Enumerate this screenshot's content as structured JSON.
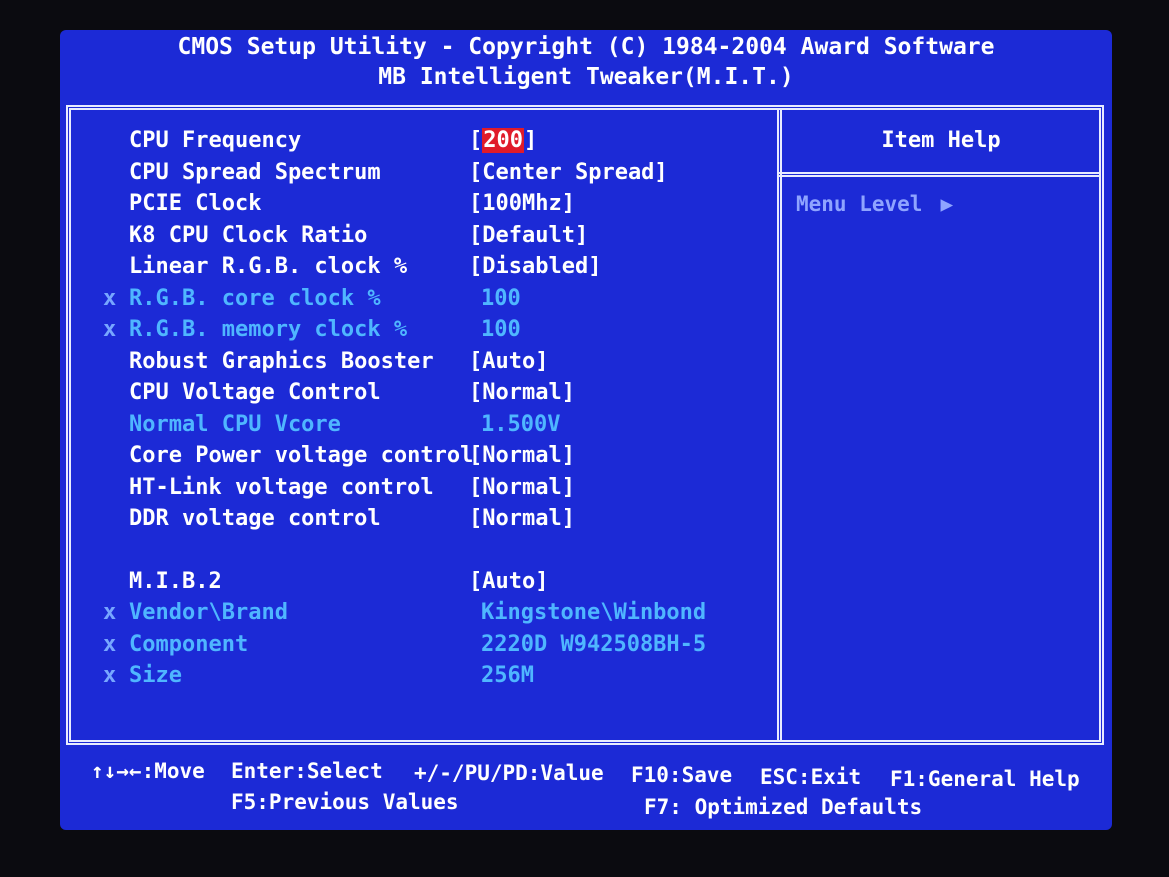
{
  "header": {
    "line1": "CMOS Setup Utility - Copyright (C) 1984-2004 Award Software",
    "line2": "MB Intelligent Tweaker(M.I.T.)"
  },
  "settings": [
    {
      "label": "CPU Frequency",
      "bracket_open": "[",
      "value": "200",
      "bracket_close": "]",
      "disabled": false,
      "mark": "",
      "selected": true
    },
    {
      "label": "CPU Spread Spectrum",
      "value": "[Center Spread]",
      "disabled": false,
      "mark": ""
    },
    {
      "label": "PCIE Clock",
      "value": "[100Mhz]",
      "disabled": false,
      "mark": ""
    },
    {
      "label": "K8 CPU Clock Ratio",
      "value": "[Default]",
      "disabled": false,
      "mark": ""
    },
    {
      "label": "Linear R.G.B. clock %",
      "value": "[Disabled]",
      "disabled": false,
      "mark": ""
    },
    {
      "label": "R.G.B. core clock %",
      "value": "100",
      "disabled": true,
      "mark": "x"
    },
    {
      "label": "R.G.B. memory clock %",
      "value": "100",
      "disabled": true,
      "mark": "x"
    },
    {
      "label": "Robust Graphics Booster",
      "value": "[Auto]",
      "disabled": false,
      "mark": ""
    },
    {
      "label": "CPU Voltage Control",
      "value": "[Normal]",
      "disabled": false,
      "mark": ""
    },
    {
      "label": "Normal CPU Vcore",
      "value": "1.500V",
      "disabled": true,
      "mark": ""
    },
    {
      "label": "Core Power voltage control",
      "value": "[Normal]",
      "disabled": false,
      "mark": ""
    },
    {
      "label": "HT-Link voltage control",
      "value": "[Normal]",
      "disabled": false,
      "mark": ""
    },
    {
      "label": "DDR voltage control",
      "value": "[Normal]",
      "disabled": false,
      "mark": ""
    },
    {
      "label": "M.I.B.2",
      "value": "[Auto]",
      "disabled": false,
      "mark": ""
    },
    {
      "label": "Vendor\\Brand",
      "value": "Kingstone\\Winbond",
      "disabled": true,
      "mark": "x"
    },
    {
      "label": "Component",
      "value": "2220D W942508BH-5",
      "disabled": true,
      "mark": "x"
    },
    {
      "label": "Size",
      "value": "256M",
      "disabled": true,
      "mark": "x"
    }
  ],
  "help": {
    "title": "Item Help",
    "menu_level": "Menu Level",
    "arrow": "▶"
  },
  "footer": {
    "move": "↑↓→←:Move",
    "select": "Enter:Select",
    "value": "+/-/PU/PD:Value",
    "save": "F10:Save",
    "exit": "ESC:Exit",
    "help": "F1:General Help",
    "previous": "F5:Previous Values",
    "defaults": "F7: Optimized Defaults"
  },
  "colors": {
    "background": "#1c2ad6",
    "text": "#ffffff",
    "disabled": "#4fb6ff",
    "highlight": "#e01b2a"
  }
}
